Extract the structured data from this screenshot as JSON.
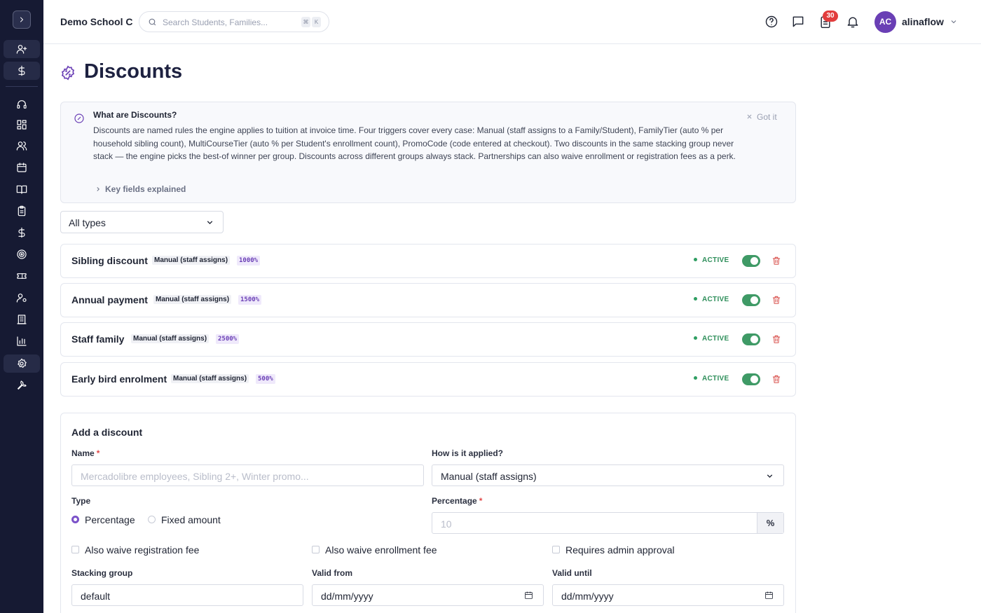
{
  "header": {
    "school_name": "Demo School C",
    "search_placeholder": "Search Students, Families...",
    "shortcut_keys": [
      "⌘",
      "K"
    ],
    "notification_count": "30",
    "user_initials": "AC",
    "username": "alinaflow"
  },
  "sidebar": {
    "icons": [
      "add-user-icon",
      "dollar-icon",
      "headset-icon",
      "dashboard-icon",
      "users-icon",
      "calendar-icon",
      "book-icon",
      "clipboard-icon",
      "dollar-icon",
      "target-icon",
      "ticket-icon",
      "user-settings-icon",
      "building-icon",
      "chart-icon",
      "settings-icon",
      "wrench-icon"
    ]
  },
  "page": {
    "title": "Discounts"
  },
  "info": {
    "title": "What are Discounts?",
    "body": "Discounts are named rules the engine applies to tuition at invoice time. Four triggers cover every case: Manual (staff assigns to a Family/Student), FamilyTier (auto % per household sibling count), MultiCourseTier (auto % per Student's enrollment count), PromoCode (code entered at checkout). Two discounts in the same stacking group never stack — the engine picks the best-of winner per group. Discounts across different groups always stack. Partnerships can also waive enrollment or registration fees as a perk.",
    "dismiss_label": "Got it",
    "key_fields_label": "Key fields explained"
  },
  "filter": {
    "selected": "All types"
  },
  "discounts": [
    {
      "name": "Sibling discount",
      "trigger": "Manual (staff assigns)",
      "value": "1000%",
      "status": "ACTIVE",
      "enabled": true
    },
    {
      "name": "Annual payment",
      "trigger": "Manual (staff assigns)",
      "value": "1500%",
      "status": "ACTIVE",
      "enabled": true
    },
    {
      "name": "Staff family",
      "trigger": "Manual (staff assigns)",
      "value": "2500%",
      "status": "ACTIVE",
      "enabled": true
    },
    {
      "name": "Early bird enrolment",
      "trigger": "Manual (staff assigns)",
      "value": "500%",
      "status": "ACTIVE",
      "enabled": true
    }
  ],
  "form": {
    "title": "Add a discount",
    "name_label": "Name",
    "name_placeholder": "Mercadolibre employees, Sibling 2+, Winter promo...",
    "applied_label": "How is it applied?",
    "applied_value": "Manual (staff assigns)",
    "type_label": "Type",
    "type_options": [
      "Percentage",
      "Fixed amount"
    ],
    "type_selected": "Percentage",
    "percentage_label": "Percentage",
    "percentage_placeholder": "10",
    "percentage_suffix": "%",
    "waive_registration_label": "Also waive registration fee",
    "waive_enrollment_label": "Also waive enrollment fee",
    "requires_approval_label": "Requires admin approval",
    "stacking_label": "Stacking group",
    "stacking_value": "default",
    "valid_from_label": "Valid from",
    "valid_from_value": "dd/mm/yyyy",
    "valid_until_label": "Valid until",
    "valid_until_value": "dd/mm/yyyy"
  },
  "colors": {
    "sidebar_bg": "#161a33",
    "accent": "#6a3fb5",
    "active_green": "#3f9a66",
    "danger": "#d9534f"
  }
}
